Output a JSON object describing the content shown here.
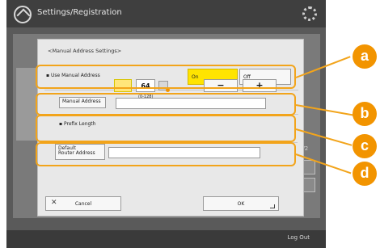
{
  "screen": {
    "title": "Settings/Registration",
    "logout_label": "Log Out",
    "side_label": "1/2"
  },
  "dialog": {
    "title": "<Manual Address Settings>",
    "use_manual": {
      "label": "Use Manual Address",
      "on_label": "On",
      "off_label": "Off",
      "selected": "On"
    },
    "manual_address": {
      "label": "Manual Address",
      "value": ""
    },
    "prefix_length": {
      "label": "Prefix Length",
      "value": "64",
      "range": "(0-128)",
      "minus": "−",
      "plus": "+"
    },
    "default_router": {
      "label_line1": "Default",
      "label_line2": "Router Address",
      "value": ""
    },
    "cancel_label": "Cancel",
    "ok_label": "OK"
  },
  "callouts": [
    "a",
    "b",
    "c",
    "d"
  ],
  "colors": {
    "accent": "#f29400",
    "frame": "#f2a41b",
    "selected": "#ffe400"
  }
}
